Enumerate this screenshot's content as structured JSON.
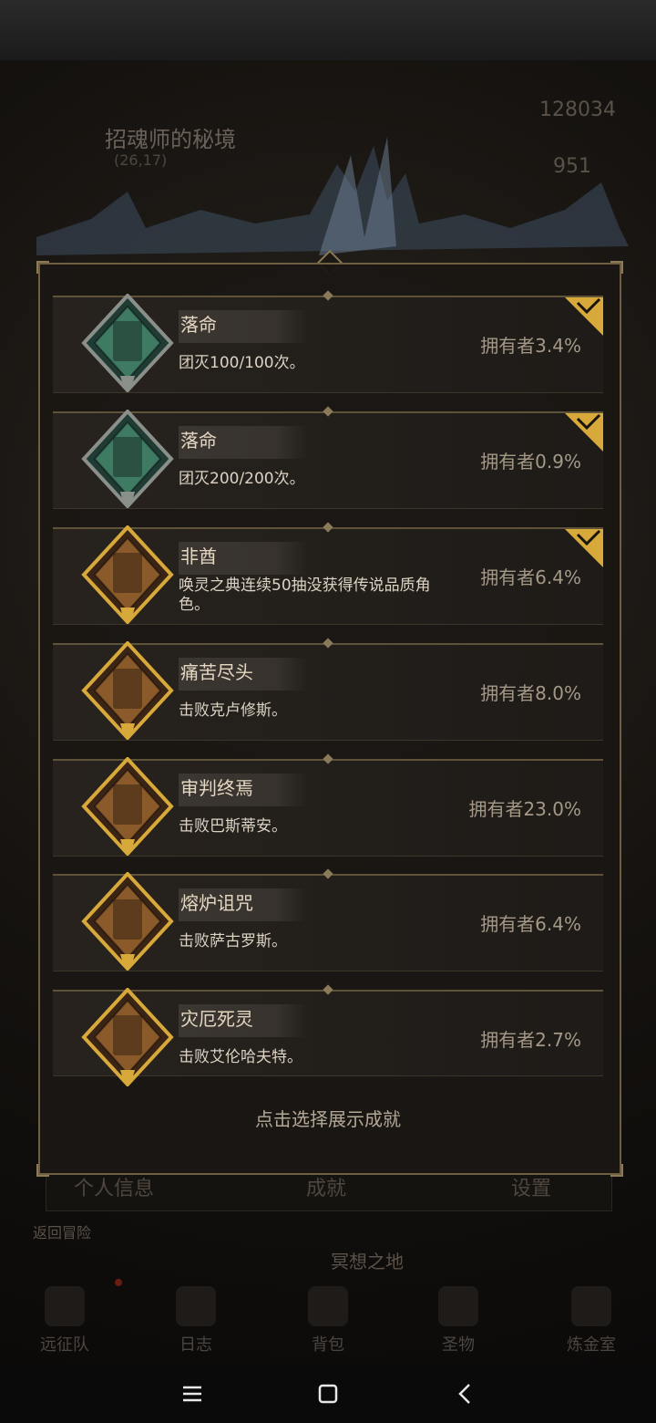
{
  "background": {
    "location_title": "招魂师的秘境",
    "location_coords": "(26,17)",
    "resource_1": "128034",
    "resource_2": "951",
    "tabs": [
      "个人信息",
      "成就",
      "设置"
    ],
    "return_label": "返回冒险",
    "land_label": "冥想之地",
    "nav": [
      "远征队",
      "日志",
      "背包",
      "圣物",
      "炼金室"
    ]
  },
  "achievements": [
    {
      "title": "落命",
      "desc": "团灭100/100次。",
      "owners": "拥有者3.4%",
      "checked": true,
      "icon": "tombstone-green-icon"
    },
    {
      "title": "落命",
      "desc": "团灭200/200次。",
      "owners": "拥有者0.9%",
      "checked": true,
      "icon": "tombstone-green-icon"
    },
    {
      "title": "非酋",
      "desc": "唤灵之典连续50抽没获得传说品质角色。",
      "owners": "拥有者6.4%",
      "checked": true,
      "icon": "warrior-gold-icon"
    },
    {
      "title": "痛苦尽头",
      "desc": "击败克卢修斯。",
      "owners": "拥有者8.0%",
      "checked": false,
      "icon": "crystal-boss-gold-icon"
    },
    {
      "title": "审判终焉",
      "desc": "击败巴斯蒂安。",
      "owners": "拥有者23.0%",
      "checked": false,
      "icon": "judge-boss-gold-icon"
    },
    {
      "title": "熔炉诅咒",
      "desc": "击败萨古罗斯。",
      "owners": "拥有者6.4%",
      "checked": false,
      "icon": "forge-boss-gold-icon"
    },
    {
      "title": "灾厄死灵",
      "desc": "击败艾伦哈夫特。",
      "owners": "拥有者2.7%",
      "checked": false,
      "icon": "necro-boss-gold-icon"
    }
  ],
  "cta": "点击选择展示成就",
  "colors": {
    "gold": "#d7a93a",
    "green_frame": "#2d5a4a",
    "silver": "#b9bcc0"
  }
}
